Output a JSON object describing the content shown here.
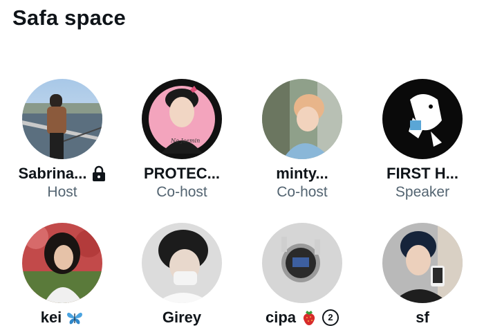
{
  "space": {
    "title": "Safa space"
  },
  "participants": [
    {
      "name": "Sabrina...",
      "role": "Host",
      "icon": "lock-icon"
    },
    {
      "name": "PROTEC...",
      "role": "Co-host",
      "avatar_text": "Na Jaemin"
    },
    {
      "name": "minty...",
      "role": "Co-host"
    },
    {
      "name": "FIRST H...",
      "role": "Speaker"
    },
    {
      "name": "kei",
      "role": "",
      "icon": "butterfly-icon"
    },
    {
      "name": "Girey",
      "role": ""
    },
    {
      "name": "cipa",
      "role": "",
      "icon": "strawberry-icon",
      "badge": "2"
    },
    {
      "name": "sf",
      "role": ""
    }
  ],
  "colors": {
    "text": "#0f1419",
    "secondary_text": "#536471",
    "background": "#ffffff"
  }
}
